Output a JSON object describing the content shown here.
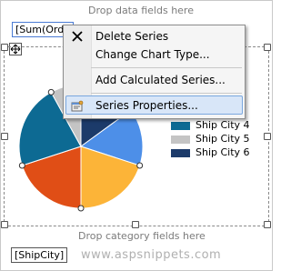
{
  "designer": {
    "drop_data_label": "Drop data fields here",
    "drop_category_label": "Drop category fields here",
    "data_field_chip": "[Sum(Orde",
    "category_field_chip": "[ShipCity]"
  },
  "context_menu": {
    "items": [
      {
        "label": "Delete Series",
        "icon": "close-icon"
      },
      {
        "label": "Change Chart Type..."
      },
      {
        "label": "Add Calculated Series..."
      },
      {
        "label": "Series Properties...",
        "icon": "properties-icon",
        "highlighted": true
      }
    ]
  },
  "legend": {
    "items": [
      {
        "label": "Ship City 4",
        "color": "#0d6a93"
      },
      {
        "label": "Ship City 5",
        "color": "#c4c4c4"
      },
      {
        "label": "Ship City 6",
        "color": "#1c3b6a"
      }
    ]
  },
  "chart_data": {
    "type": "pie",
    "slices": [
      {
        "color": "#1c3b6a",
        "value": 15
      },
      {
        "color": "#4d8fe8",
        "value": 15
      },
      {
        "color": "#fcb438",
        "value": 20
      },
      {
        "color": "#e04e16",
        "value": 20
      },
      {
        "color": "#0d6a93",
        "value": 22
      },
      {
        "color": "#c4c4c4",
        "value": 8
      }
    ]
  },
  "watermark": {
    "text": "www.aspsnippets.com"
  }
}
